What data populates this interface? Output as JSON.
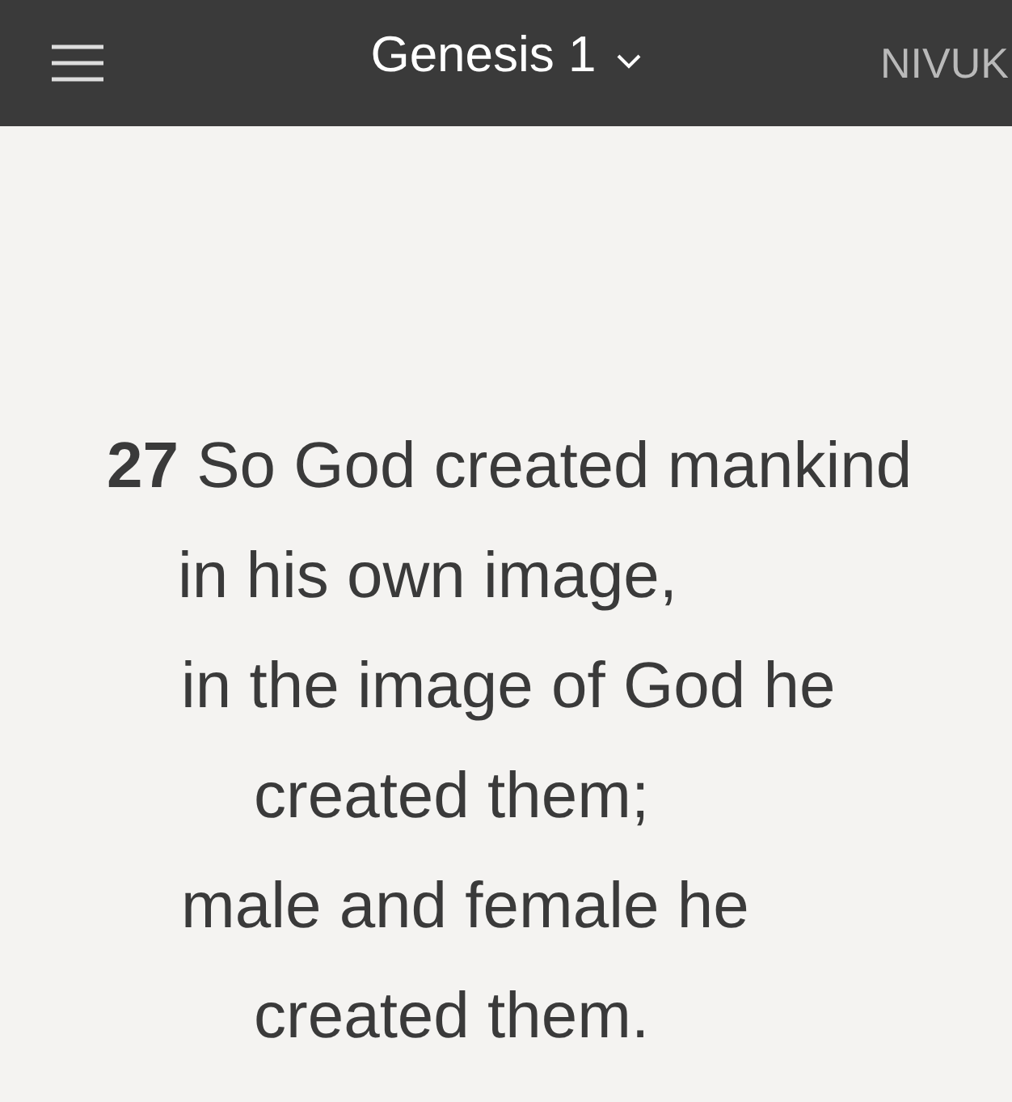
{
  "header": {
    "title": "Genesis 1",
    "version": "NIVUK"
  },
  "verse": {
    "number": "27",
    "lines": [
      "So God created mankind in his own image,",
      "in the image of God he created them;",
      "male and female he created them."
    ]
  }
}
